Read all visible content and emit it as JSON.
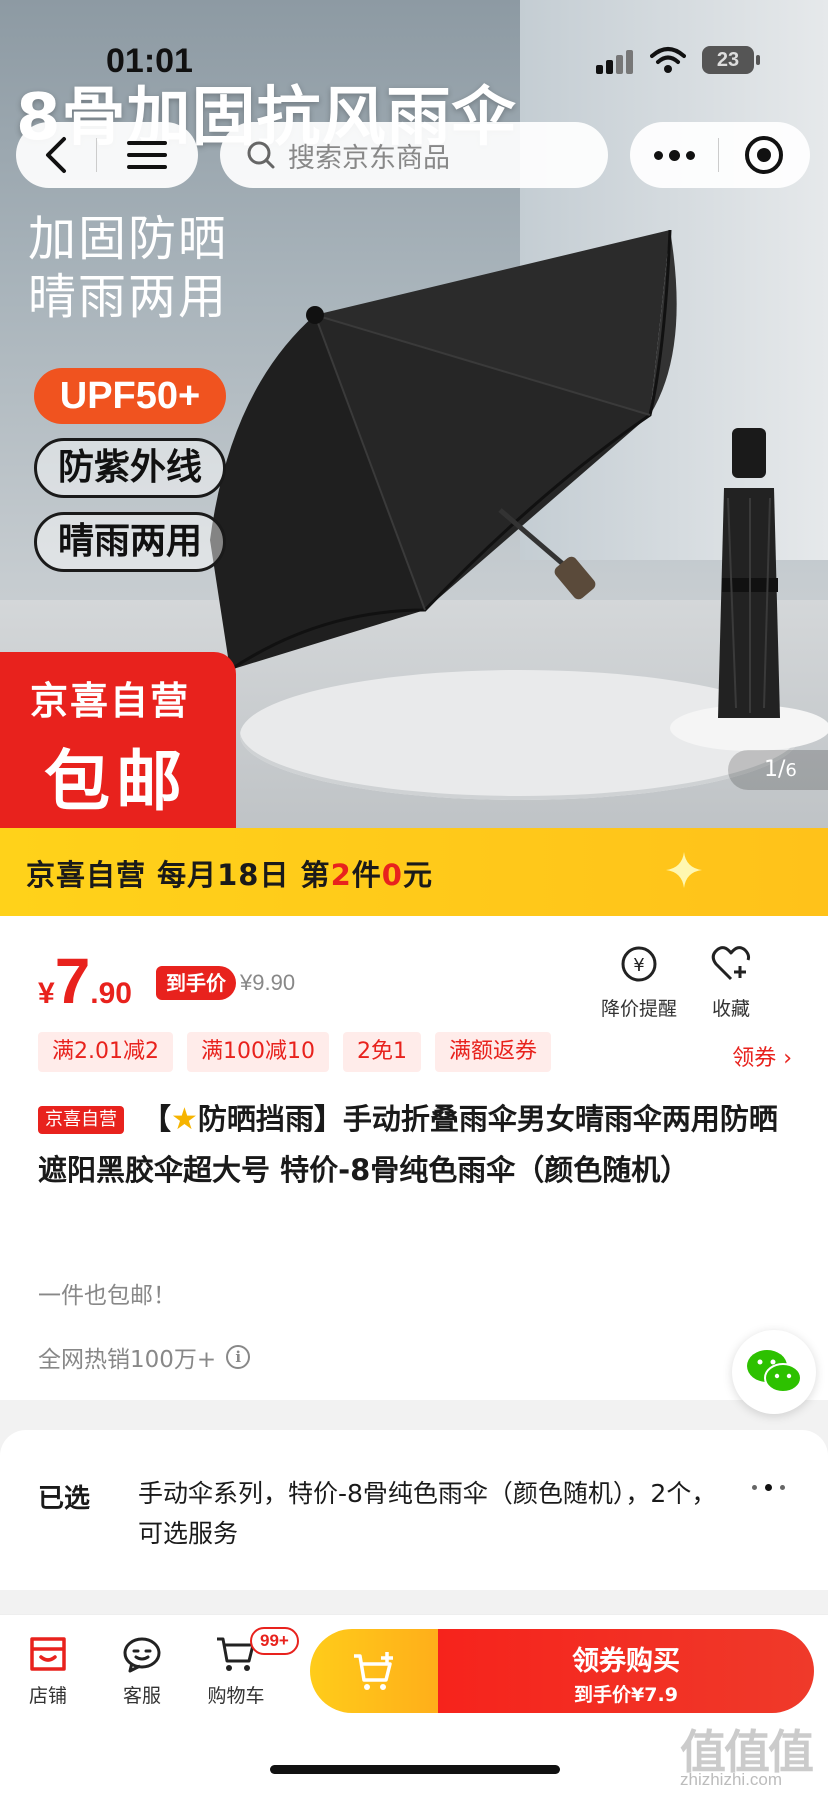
{
  "status_bar": {
    "time": "01:01",
    "battery": "23"
  },
  "hero": {
    "title_overlay": "8骨加固抗风雨伞",
    "slogan_line1": "加固防晒",
    "slogan_line2": "晴雨两用",
    "tag_upf": "UPF50+",
    "tag_uv": "防紫外线",
    "tag_dual": "晴雨两用",
    "red_line1": "京喜自营",
    "red_line2": "包邮",
    "image_counter_current": "1",
    "image_counter_total": "6"
  },
  "nav": {
    "search_placeholder": "搜索京东商品",
    "back_icon": "chevron-left-icon",
    "menu_icon": "hamburger-icon"
  },
  "promo_banner": {
    "part1": "京喜自营  每月18日  第",
    "hl1": "2",
    "part2": "件",
    "hl2": "0",
    "part3": "元"
  },
  "price": {
    "currency": "¥",
    "integer": "7",
    "decimal": ".90",
    "hand_label": "到手价",
    "original": "¥9.90",
    "alert_label": "降价提醒",
    "fav_label": "收藏"
  },
  "coupons": [
    "满2.01减2",
    "满100减10",
    "2免1",
    "满额返券"
  ],
  "get_coupon": "领券 ›",
  "product": {
    "self_badge": "京喜自营",
    "title_head": "【",
    "title_after_star": "防晒挡雨】手动折叠雨伞男女晴雨伞两用防晒遮阳黑胶伞超大号 特价-8骨纯色雨伞（颜色随机）",
    "free_shipping": "一件也包邮！",
    "hot_sales": "全网热销100万+"
  },
  "selected": {
    "label": "已选",
    "value": "手动伞系列，特价-8骨纯色雨伞（颜色随机），2个，可选服务"
  },
  "bottom_bar": {
    "store": "店铺",
    "service": "客服",
    "cart": "购物车",
    "cart_badge": "99+",
    "buy_line1": "领券购买",
    "buy_line2": "到手价¥7.9"
  },
  "watermark": {
    "logo": "值值值",
    "url": "zhizhizhi.com"
  },
  "colors": {
    "accent_red": "#e8221d",
    "promo_yellow": "#ffd21a",
    "upf_orange": "#f0531f"
  }
}
